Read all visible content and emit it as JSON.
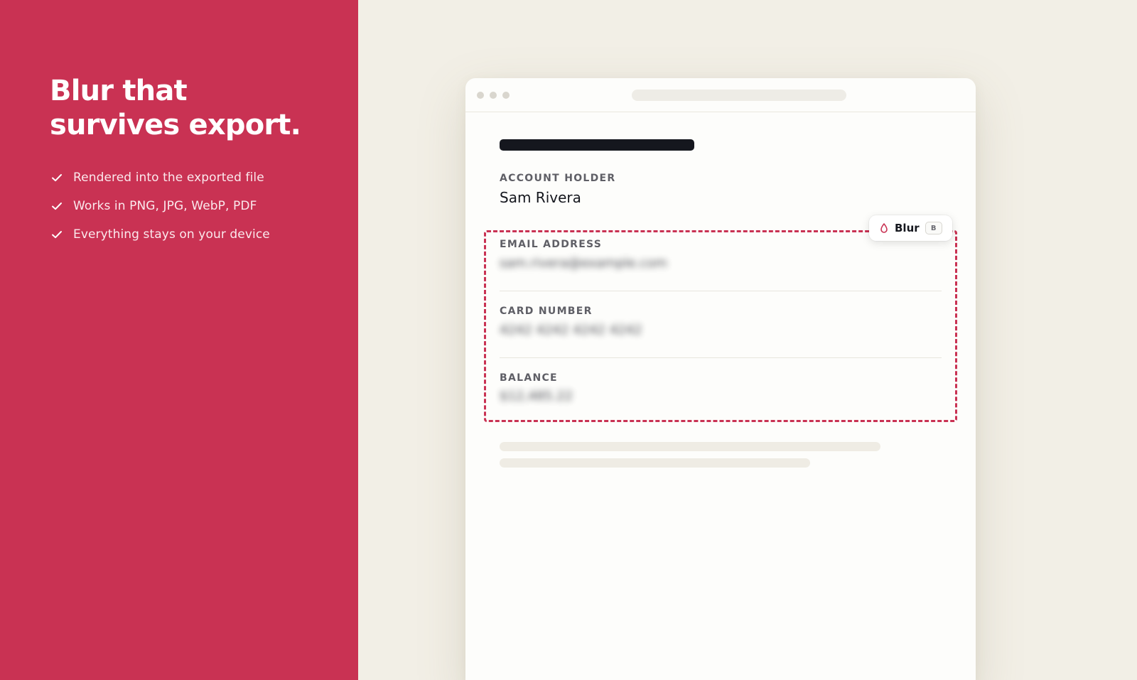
{
  "hero": {
    "headline_line1": "Blur that",
    "headline_line2": "survives export.",
    "features": [
      "Rendered into the exported file",
      "Works in PNG, JPG, WebP, PDF",
      "Everything stays on your device"
    ]
  },
  "document": {
    "fields": [
      {
        "label": "ACCOUNT HOLDER",
        "value": "Sam Rivera",
        "blurred": false
      },
      {
        "label": "EMAIL ADDRESS",
        "value": "sam.rivera@example.com",
        "blurred": true
      },
      {
        "label": "CARD NUMBER",
        "value": "4242 4242 4242 4242",
        "blurred": true
      },
      {
        "label": "BALANCE",
        "value": "$12,485.22",
        "blurred": true
      }
    ]
  },
  "tool_badge": {
    "label": "Blur",
    "shortcut": "B",
    "icon": "droplet-icon"
  },
  "colors": {
    "brand": "#c93253",
    "background": "#f2efe6",
    "card": "#fdfdfb",
    "ink": "#15171e"
  }
}
